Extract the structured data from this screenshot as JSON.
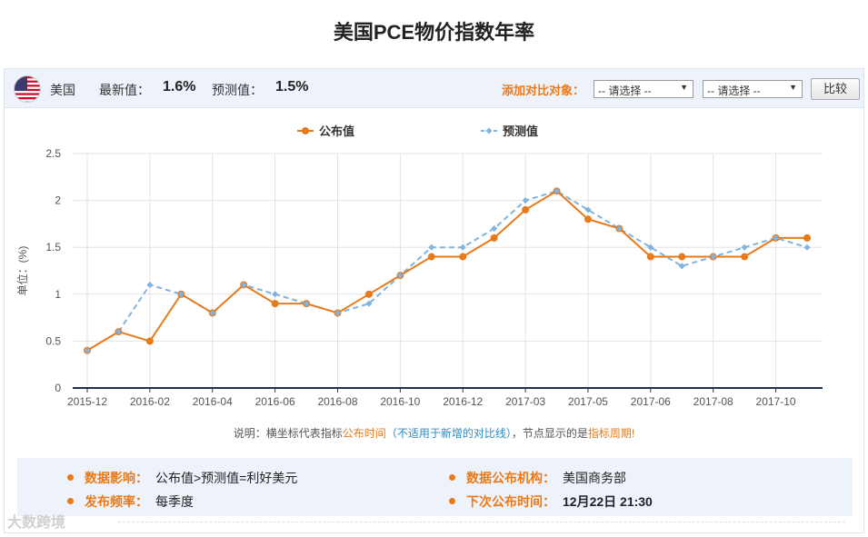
{
  "page": {
    "title": "美国PCE物价指数年率"
  },
  "header": {
    "country": "美国",
    "latest_label": "最新值：",
    "latest_value": "1.6%",
    "forecast_label": "预测值：",
    "forecast_value": "1.5%",
    "compare_label": "添加对比对象：",
    "select1": "-- 请选择 --",
    "select2": "-- 请选择 --",
    "compare_button": "比较"
  },
  "note": {
    "part1": "说明：横坐标代表指标",
    "part2": "公布时间",
    "part3": "（不适用于新增的对比线）",
    "part4": "，节点显示的是",
    "part5": "指标周期",
    "part6": "!"
  },
  "info": {
    "impact_label": "数据影响：",
    "impact_value": "公布值>预测值=利好美元",
    "agency_label": "数据公布机构：",
    "agency_value": "美国商务部",
    "freq_label": "发布频率：",
    "freq_value": "每季度",
    "next_label": "下次公布时间：",
    "next_value": "12月22日 21:30"
  },
  "watermark": "大数跨境",
  "colors": {
    "actual": "#e97a1a",
    "forecast": "#7fb3e0",
    "accent": "#e97a1a",
    "panel_bg": "#eef3fb"
  },
  "chart_data": {
    "type": "line",
    "ylabel": "单位：(%)",
    "ylim": [
      0,
      2.5
    ],
    "yticks": [
      "0",
      "0.5",
      "1",
      "1.5",
      "2",
      "2.5"
    ],
    "x_tick_labels": [
      "2015-12",
      "2016-02",
      "2016-04",
      "2016-06",
      "2016-08",
      "2016-10",
      "2016-12",
      "2017-03",
      "2017-05",
      "2017-06",
      "2017-08",
      "2017-10"
    ],
    "point_count": 24,
    "series": [
      {
        "name": "公布值",
        "values": [
          0.4,
          0.6,
          0.5,
          1.0,
          0.8,
          1.1,
          0.9,
          0.9,
          0.8,
          1.0,
          1.2,
          1.4,
          1.4,
          1.6,
          1.9,
          2.1,
          1.8,
          1.7,
          1.4,
          1.4,
          1.4,
          1.4,
          1.6,
          1.6
        ]
      },
      {
        "name": "预测值",
        "values": [
          0.4,
          0.6,
          1.1,
          1.0,
          0.8,
          1.1,
          1.0,
          0.9,
          0.8,
          0.9,
          1.2,
          1.5,
          1.5,
          1.7,
          2.0,
          2.1,
          1.9,
          1.7,
          1.5,
          1.3,
          1.4,
          1.5,
          1.6,
          1.5
        ]
      }
    ],
    "grid": true,
    "legend_position": "top-center"
  }
}
